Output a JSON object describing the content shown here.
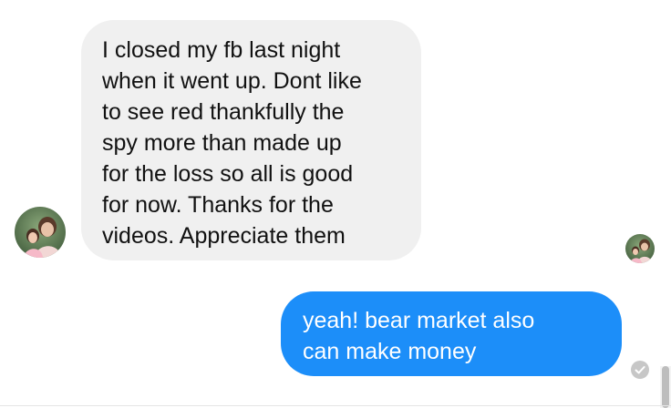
{
  "conversation": {
    "messages": [
      {
        "direction": "incoming",
        "text": "I closed my fb last night\nwhen it went up. Dont like\nto see red  thankfully the\nspy more than made up\nfor the loss so all is good\nfor now. Thanks for the\nvideos. Appreciate them"
      },
      {
        "direction": "outgoing",
        "text": "yeah! bear market also\ncan make money"
      }
    ],
    "contact_avatar_icon": "person-photo-avatar",
    "seen_avatar_icon": "person-photo-avatar",
    "status_icon": "delivered-check-icon"
  },
  "colors": {
    "incoming_bubble": "#f0f0f0",
    "outgoing_bubble": "#1c8ef9",
    "outgoing_text": "#ffffff",
    "incoming_text": "#111111",
    "status_icon": "#c7c7c7"
  }
}
